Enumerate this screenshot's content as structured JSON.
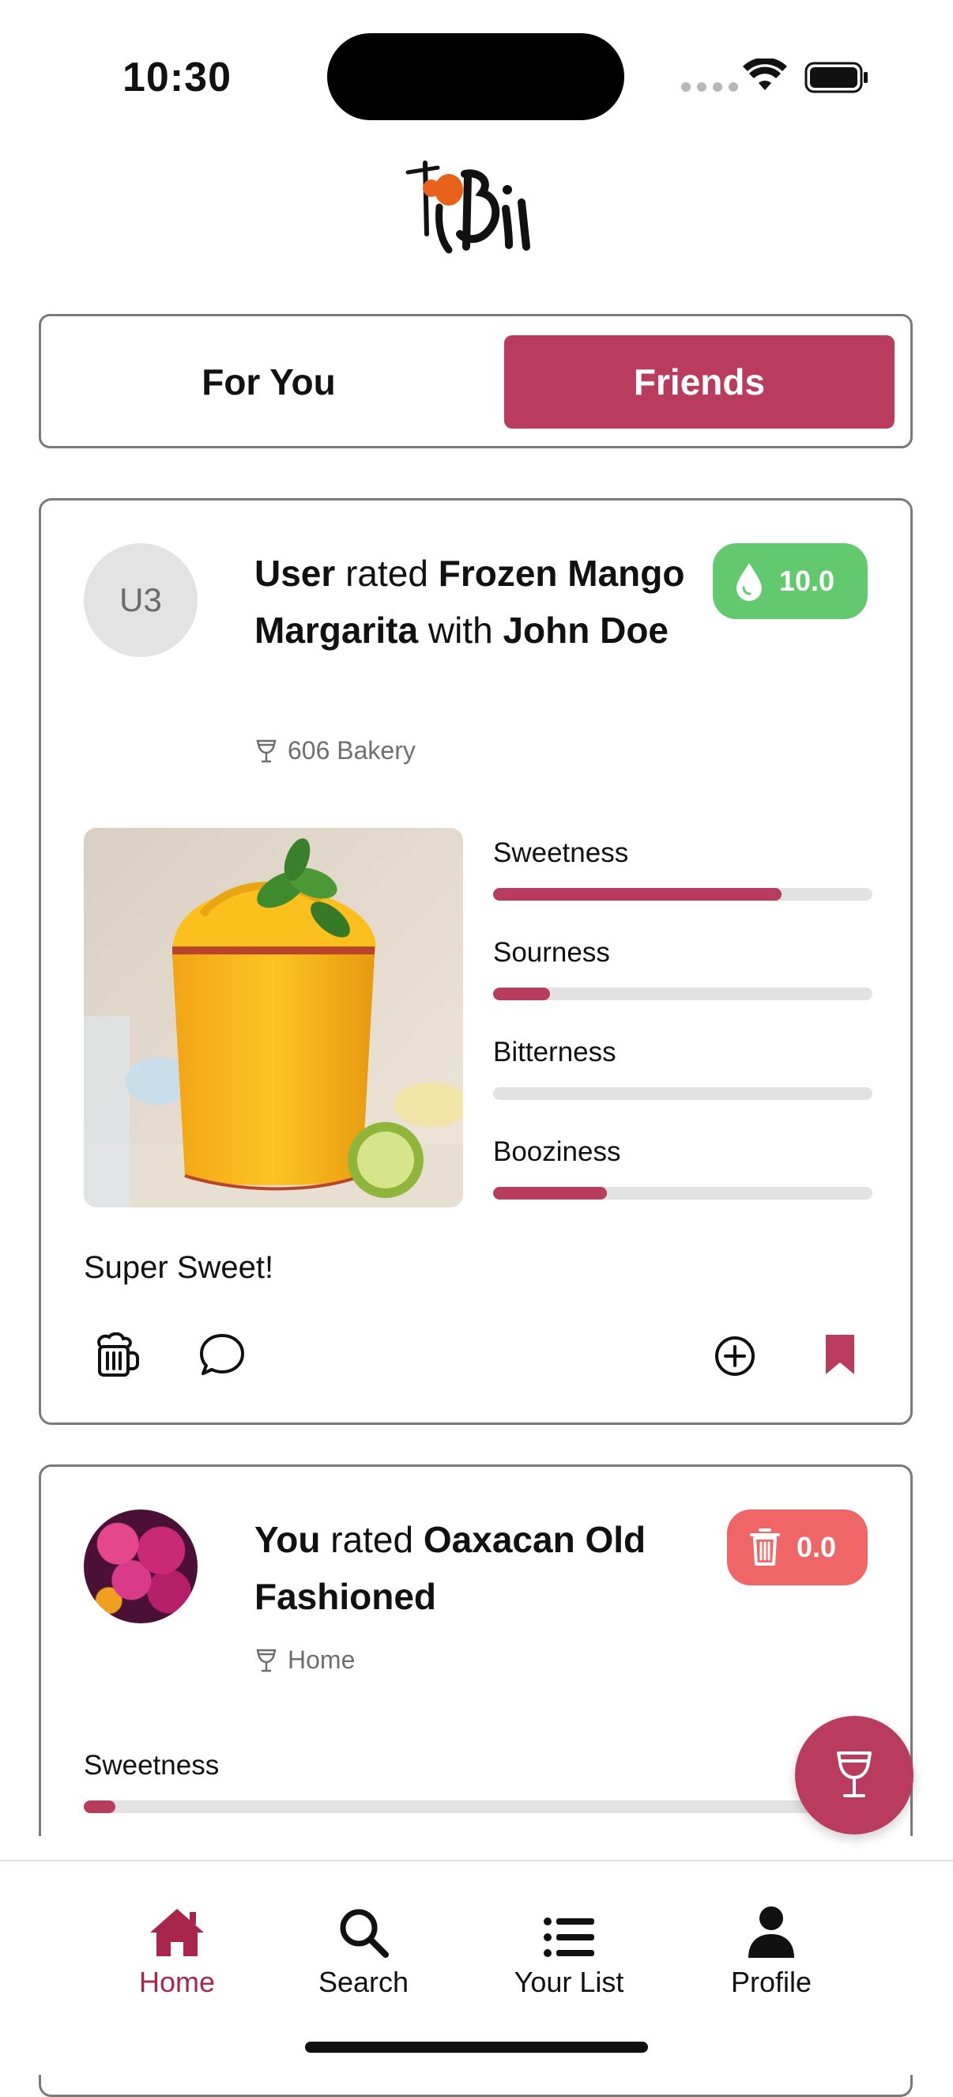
{
  "status_bar": {
    "time": "10:30"
  },
  "app": {
    "logo_text": "tipsi"
  },
  "tabs": [
    {
      "label": "For You",
      "active": false
    },
    {
      "label": "Friends",
      "active": true
    }
  ],
  "colors": {
    "accent": "#b93b5d",
    "score_high": "#62c96e",
    "score_low": "#f06565"
  },
  "feed": [
    {
      "avatar_initials": "U3",
      "user": "User",
      "verb": "rated",
      "drink": "Frozen Mango Margarita",
      "connector": "with",
      "companion": "John Doe",
      "venue": "606 Bakery",
      "score": "10.0",
      "score_icon": "droplet-icon",
      "metrics": [
        {
          "label": "Sweetness",
          "value": 0.76
        },
        {
          "label": "Sourness",
          "value": 0.15
        },
        {
          "label": "Bitterness",
          "value": 0.0
        },
        {
          "label": "Booziness",
          "value": 0.3
        }
      ],
      "comment": "Super Sweet!",
      "actions": [
        "cheers-mug-icon",
        "comment-icon",
        "add-circle-icon",
        "bookmark-icon"
      ]
    },
    {
      "user": "You",
      "verb": "rated",
      "drink": "Oaxacan Old Fashioned",
      "venue": "Home",
      "score": "0.0",
      "score_icon": "trash-icon",
      "metrics": [
        {
          "label": "Sweetness",
          "value": 0.04
        }
      ]
    }
  ],
  "fab": {
    "icon": "wine-glass-icon"
  },
  "nav": [
    {
      "label": "Home",
      "icon": "home-icon",
      "active": true
    },
    {
      "label": "Search",
      "icon": "search-icon",
      "active": false
    },
    {
      "label": "Your List",
      "icon": "list-icon",
      "active": false
    },
    {
      "label": "Profile",
      "icon": "person-icon",
      "active": false
    }
  ]
}
